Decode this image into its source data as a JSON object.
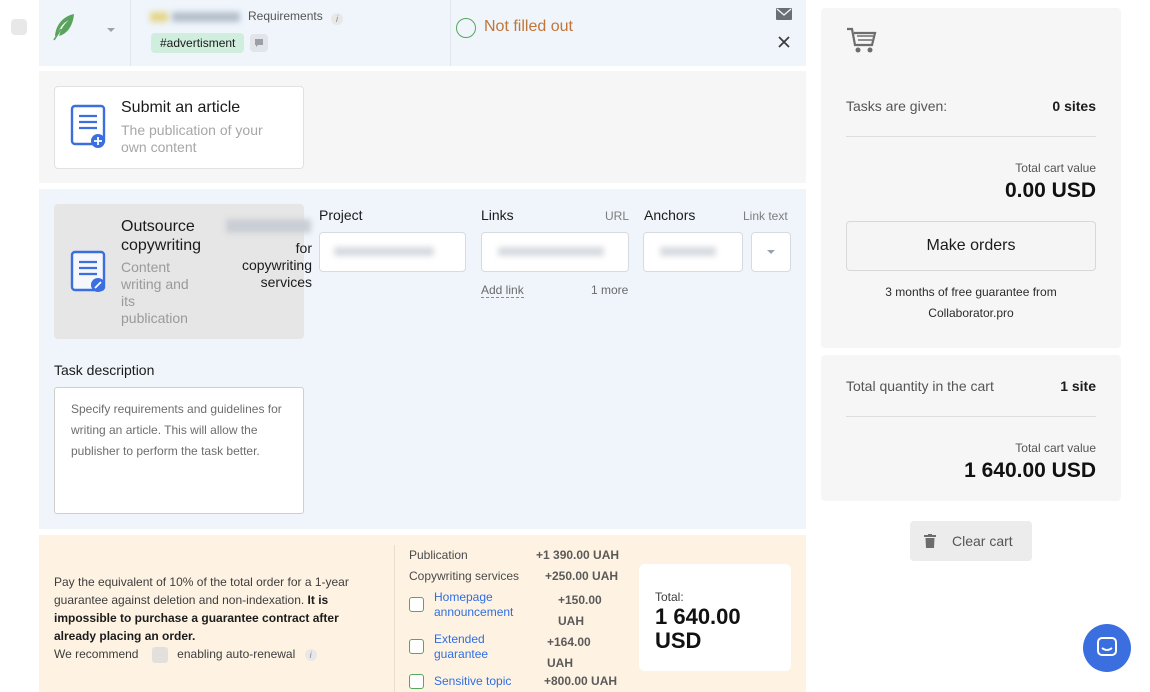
{
  "order_row": {
    "requirements_label": "Requirements",
    "tag": "#advertisment",
    "status": "Not filled out",
    "info_icon": "info-icon",
    "mail_icon": "mail-icon",
    "close_icon": "close-icon"
  },
  "submit_article": {
    "title": "Submit an article",
    "subtitle": "The publication of your own content"
  },
  "outsource": {
    "title": "Outsource copywriting",
    "subtitle": "Content writing and its publication",
    "price_suffix": "for copywriting services"
  },
  "project": {
    "label": "Project"
  },
  "links": {
    "label": "Links",
    "hint": "URL",
    "add_link": "Add link",
    "more": "1 more"
  },
  "anchors": {
    "label": "Anchors",
    "hint": "Link text"
  },
  "task": {
    "label": "Task description",
    "placeholder": "Specify requirements and guidelines for writing an article. This will allow the publisher to perform the task better."
  },
  "guarantee": {
    "text": "Pay the equivalent of 10% of the total order for a 1-year guarantee against deletion and non-indexation.",
    "bold": "It is impossible to purchase a guarantee contract after already placing an order.",
    "recommend": "We recommend",
    "auto_renewal": "enabling auto-renewal"
  },
  "pricing": {
    "publication_label": "Publication",
    "publication_value": "+1 390.00 UAH",
    "copywriting_label": "Copywriting services",
    "copywriting_value": "+250.00 UAH",
    "options": [
      {
        "label": "Homepage announcement",
        "value": "+150.00 UAH"
      },
      {
        "label": "Extended guarantee",
        "value": "+164.00 UAH"
      },
      {
        "label": "Sensitive topic",
        "value": "+800.00 UAH"
      }
    ],
    "total_label": "Total:",
    "total_value": "1 640.00 USD"
  },
  "cart": {
    "icon": "cart-icon",
    "tasks_label": "Tasks are given:",
    "tasks_value": "0 sites",
    "total_label": "Total cart value",
    "total_value": "0.00 USD",
    "make_orders": "Make orders",
    "guarantee_note": "3 months of free guarantee from Collaborator.pro"
  },
  "cart_summary": {
    "quantity_label": "Total quantity in the cart",
    "quantity_value": "1 site",
    "total_label": "Total cart value",
    "total_value": "1 640.00 USD"
  },
  "clear_cart": {
    "label": "Clear cart",
    "icon": "trash-icon"
  },
  "chat": {
    "icon": "chat-icon"
  },
  "colors": {
    "accent": "#3b6fe0",
    "success": "#57a85a",
    "warning": "#c0763a"
  }
}
